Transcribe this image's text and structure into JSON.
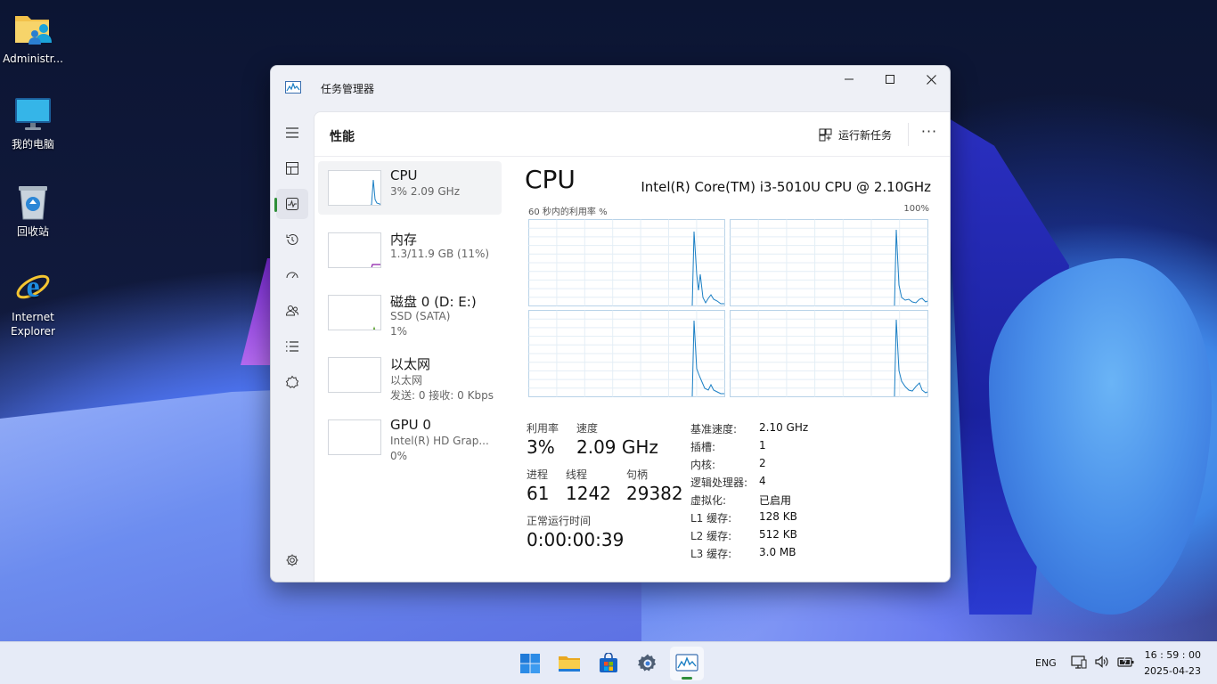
{
  "desktop": {
    "icons": [
      {
        "label": "Administr...",
        "icon": "user-folder-icon"
      },
      {
        "label": "我的电脑",
        "icon": "computer-icon"
      },
      {
        "label": "回收站",
        "icon": "recycle-bin-icon"
      },
      {
        "label": "Internet Explorer",
        "icon": "internet-explorer-icon"
      }
    ]
  },
  "window": {
    "title": "任务管理器",
    "controls": [
      "minimize",
      "maximize",
      "close"
    ]
  },
  "nav": {
    "items": [
      {
        "icon": "hamburger-menu-icon"
      },
      {
        "icon": "processes-icon"
      },
      {
        "icon": "performance-icon",
        "active": true
      },
      {
        "icon": "app-history-icon"
      },
      {
        "icon": "startup-apps-icon"
      },
      {
        "icon": "users-icon"
      },
      {
        "icon": "details-icon"
      },
      {
        "icon": "services-icon"
      }
    ],
    "settings_icon": "settings-icon"
  },
  "header": {
    "title": "性能",
    "run_new_task": "运行新任务",
    "more": "···"
  },
  "resources": [
    {
      "name": "CPU",
      "sub1": "3% 2.09 GHz",
      "sub2": ""
    },
    {
      "name": "内存",
      "sub1": "1.3/11.9 GB (11%)",
      "sub2": ""
    },
    {
      "name": "磁盘 0 (D: E:)",
      "sub1": "SSD (SATA)",
      "sub2": "1%"
    },
    {
      "name": "以太网",
      "sub1": "以太网",
      "sub2": "发送: 0 接收: 0 Kbps"
    },
    {
      "name": "GPU 0",
      "sub1": "Intel(R) HD Grap...",
      "sub2": "0%"
    }
  ],
  "cpu": {
    "title": "CPU",
    "model": "Intel(R) Core(TM) i3-5010U CPU @ 2.10GHz",
    "graph_label": "60 秒内的利用率 %",
    "graph_max": "100%",
    "utilization_label": "利用率",
    "utilization": "3%",
    "speed_label": "速度",
    "speed": "2.09 GHz",
    "processes_label": "进程",
    "processes": "61",
    "threads_label": "线程",
    "threads": "1242",
    "handles_label": "句柄",
    "handles": "29382",
    "uptime_label": "正常运行时间",
    "uptime": "0:00:00:39",
    "specs": [
      {
        "k": "基准速度:",
        "v": "2.10 GHz"
      },
      {
        "k": "插槽:",
        "v": "1"
      },
      {
        "k": "内核:",
        "v": "2"
      },
      {
        "k": "逻辑处理器:",
        "v": "4"
      },
      {
        "k": "虚拟化:",
        "v": "已启用"
      },
      {
        "k": "L1 缓存:",
        "v": "128 KB"
      },
      {
        "k": "L2 缓存:",
        "v": "512 KB"
      },
      {
        "k": "L3 缓存:",
        "v": "3.0 MB"
      }
    ]
  },
  "taskbar": {
    "apps": [
      "start-icon",
      "file-explorer-icon",
      "store-icon",
      "settings-gear-icon",
      "task-manager-icon"
    ],
    "language": "ENG",
    "time": "16 : 59 : 00",
    "date": "2025-04-23"
  },
  "colors": {
    "graph_line": "#1b7fc4",
    "accent_green": "#2f8f3a"
  }
}
